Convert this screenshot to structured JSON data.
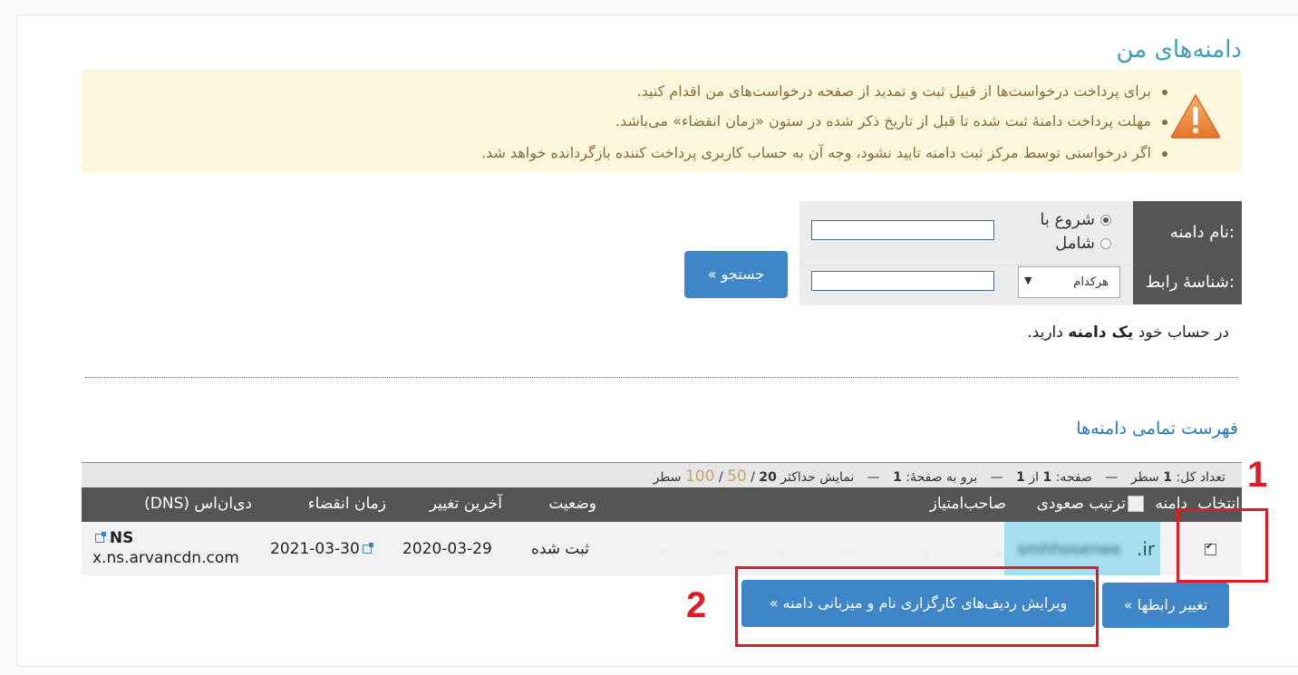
{
  "page": {
    "title": "دامنه‌های من"
  },
  "warnings": [
    "برای پرداخت درخواست‌ها از قبیل ثبت و تمدید از صفحه درخواست‌های من اقدام کنید.",
    "مهلت پرداخت دامنهٔ ثبت شده تا قبل از تاریخ ذکر شده در ستون «زمان انقضاء» می‌باشد.",
    "اگر درخواستی توسط مرکز ثبت دامنه تایید نشود، وجه آن به حساب کاربری پرداخت کننده بازگردانده خواهد شد."
  ],
  "warning_icon": "warning-triangle-icon",
  "search_form": {
    "domain_label": "نام دامنه:",
    "handle_label": "شناسهٔ رابط:",
    "radio_options": [
      "شروع با",
      "شامل"
    ],
    "selected_radio": "شروع با",
    "domain_input_value": "",
    "handle_input_value": "",
    "handle_select_value": "هرکدام",
    "search_button": "جستجو »"
  },
  "account_summary": {
    "prefix": "در حساب خود",
    "count": "یک دامنه",
    "suffix": "دارید."
  },
  "list_title": "فهرست تمامی دامنه‌ها",
  "pagination": {
    "total_label": "تعداد کل:",
    "total_value": "1",
    "total_unit": "سطر",
    "page_label": "صفحه:",
    "page_value": "1",
    "of_label": "از",
    "page_total": "1",
    "goto_label": "برو به صفحهٔ:",
    "goto_value": "1",
    "show_max_label": "نمایش حداکثر",
    "show_max_value": "20",
    "option_50": "50",
    "option_100": "100",
    "rows_unit": "سطر",
    "separator": "—",
    "slash": "/"
  },
  "table": {
    "headers": {
      "select": "انتخاب",
      "domain": "دامنه",
      "sort_icon_alt": "ترتیب صعودی",
      "owner": "صاحب‌امتیاز",
      "status": "وضعیت",
      "last_change": "آخرین تغییر",
      "expiry": "زمان انقضاء",
      "dns": "دی‌ان‌اس (DNS)"
    },
    "rows": [
      {
        "selected": true,
        "domain_blurred": "smhhosenee",
        "domain_tld": ".ir",
        "status": "ثبت شده",
        "last_change": "2020-03-29",
        "expiry": "2021-03-30",
        "dns_label": "NS",
        "dns_value": "x.ns.arvancdn.com"
      }
    ]
  },
  "actions": {
    "change_handles": "تغییر رابطها »",
    "edit_ns": "ویرایش ردیف‌های کارگزاری نام و میزبانی دامنه »"
  },
  "annotations": {
    "label_1": "1",
    "label_2": "2",
    "color": "#e01b24"
  },
  "colors": {
    "accent": "#3e86c8",
    "title": "#3e9fb7",
    "header_bg": "#555555",
    "warning_bg": "#fcf6dd",
    "warning_text": "#8a6d3b",
    "highlight_cell": "#a8dff0"
  }
}
